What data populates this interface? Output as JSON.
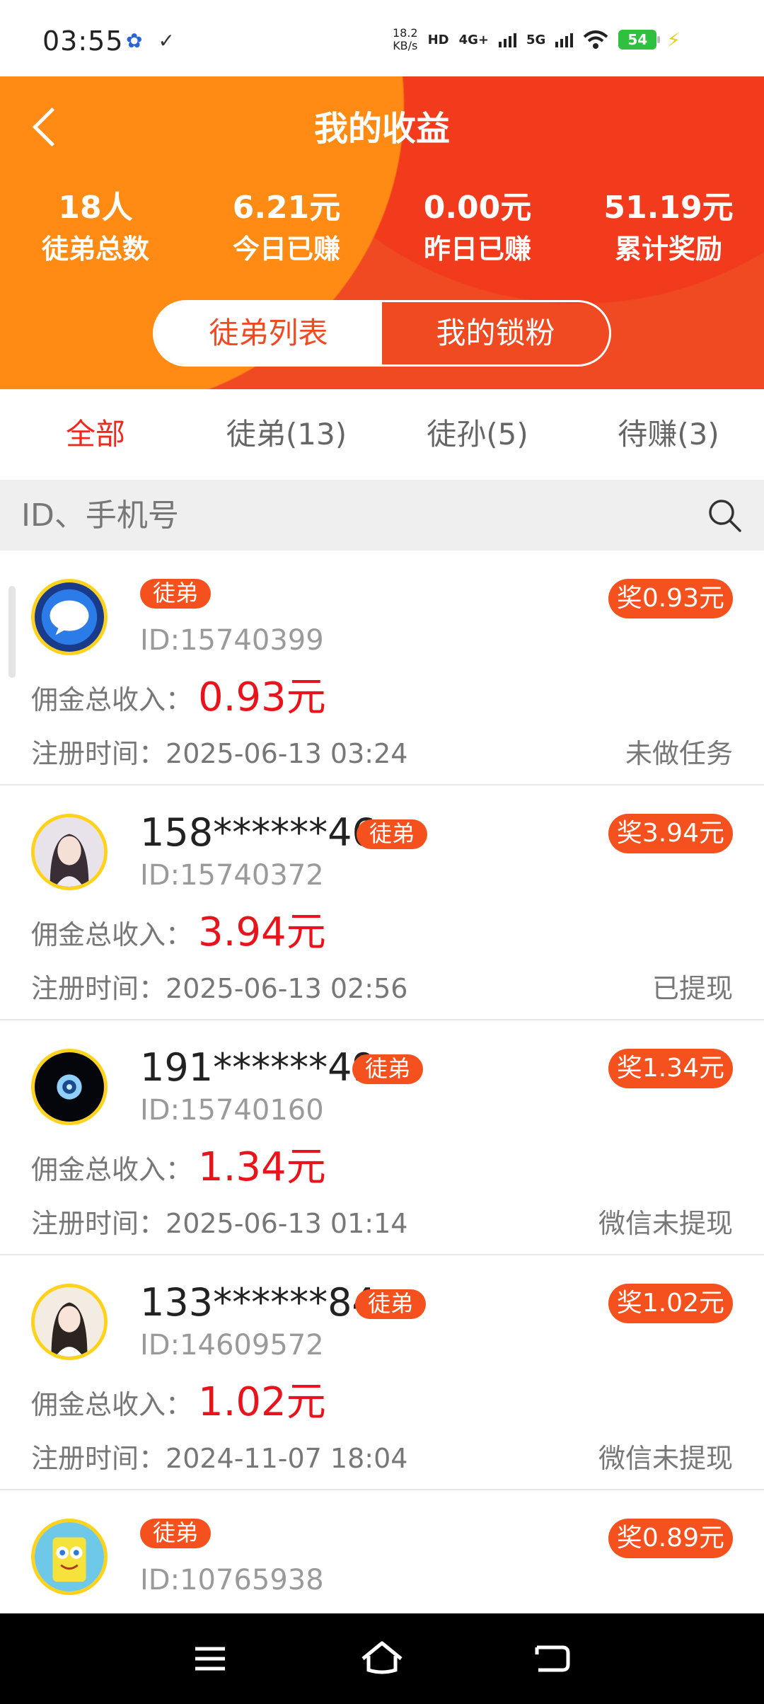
{
  "status_bar": {
    "time": "03:55",
    "net_speed_value": "18.2",
    "net_speed_unit": "KB/s",
    "hd": "HD",
    "sim1": "4G+",
    "sim2": "5G",
    "battery": "54"
  },
  "header": {
    "title": "我的收益",
    "stats": [
      {
        "value": "18人",
        "label": "徒弟总数"
      },
      {
        "value": "6.21元",
        "label": "今日已赚"
      },
      {
        "value": "0.00元",
        "label": "昨日已赚"
      },
      {
        "value": "51.19元",
        "label": "累计奖励"
      }
    ],
    "toggle": [
      "徒弟列表",
      "我的锁粉"
    ]
  },
  "tabs": [
    "全部",
    "徒弟(13)",
    "徒孙(5)",
    "待赚(3)"
  ],
  "search": {
    "placeholder": "ID、手机号"
  },
  "labels": {
    "income": "佣金总收入：",
    "reg": "注册时间："
  },
  "list": [
    {
      "phone": "",
      "tag": "徒弟",
      "id": "ID:15740399",
      "reward": "奖0.93元",
      "income": "0.93元",
      "reg_time": "2025-06-13 03:24",
      "status": "未做任务"
    },
    {
      "phone": "158******46",
      "tag": "徒弟",
      "id": "ID:15740372",
      "reward": "奖3.94元",
      "income": "3.94元",
      "reg_time": "2025-06-13 02:56",
      "status": "已提现"
    },
    {
      "phone": "191******49",
      "tag": "徒弟",
      "id": "ID:15740160",
      "reward": "奖1.34元",
      "income": "1.34元",
      "reg_time": "2025-06-13 01:14",
      "status": "微信未提现"
    },
    {
      "phone": "133******84",
      "tag": "徒弟",
      "id": "ID:14609572",
      "reward": "奖1.02元",
      "income": "1.02元",
      "reg_time": "2024-11-07 18:04",
      "status": "微信未提现"
    },
    {
      "phone": "",
      "tag": "徒弟",
      "id": "ID:10765938",
      "reward": "奖0.89元",
      "income": "",
      "reg_time": "",
      "status": ""
    }
  ],
  "colors": {
    "accent": "#f04a22",
    "orange": "#ff8a14",
    "tag": "#f5511e",
    "income": "#e8141c",
    "active_tab": "#f0281e"
  }
}
